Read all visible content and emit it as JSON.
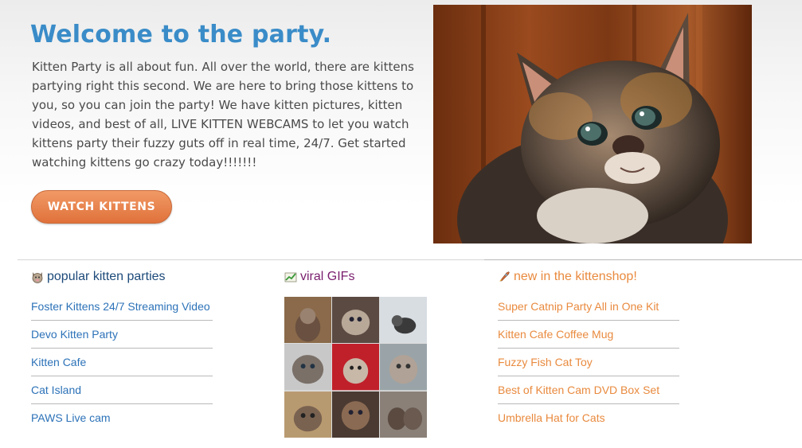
{
  "hero": {
    "title": "Welcome to the party.",
    "text": "Kitten Party is all about fun. All over the world, there are kittens partying right this second. We are here to bring those kittens to you, so you can join the party! We have kitten pictures, kitten videos, and best of all, LIVE KITTEN WEBCAMS to let you watch kittens party their fuzzy guts off in real time, 24/7. Get started watching kittens go crazy today!!!!!!!",
    "cta_label": "WATCH KITTENS"
  },
  "popular": {
    "icon": "cat-face-icon",
    "title": "popular kitten parties",
    "items": [
      "Foster Kittens 24/7 Streaming Video",
      "Devo Kitten Party",
      "Kitten Cafe",
      "Cat Island",
      "PAWS Live cam"
    ]
  },
  "gifs": {
    "icon": "chart-icon",
    "title": "viral GIFs"
  },
  "shop": {
    "icon": "rocket-icon",
    "title": "new in the kittenshop!",
    "items": [
      "Super Catnip Party All in One Kit",
      "Kitten Cafe Coffee Mug",
      "Fuzzy Fish Cat Toy",
      "Best of Kitten Cam DVD Box Set",
      "Umbrella Hat for Cats"
    ]
  },
  "colors": {
    "title_blue": "#3a8cc8",
    "link_blue": "#2c72b8",
    "link_orange": "#e98a3e",
    "cta_orange": "#e0713b",
    "gif_title_purple": "#7a1e6e",
    "popular_title_navy": "#1d4a7a"
  }
}
